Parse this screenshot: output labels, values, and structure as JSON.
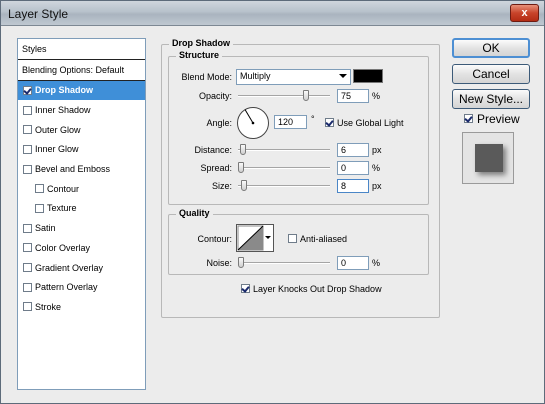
{
  "window": {
    "title": "Layer Style",
    "close_label": "x"
  },
  "styles_panel": {
    "header": "Styles",
    "blending_options": "Blending Options: Default",
    "items": [
      {
        "label": "Drop Shadow",
        "checked": true,
        "active": true,
        "sub": false
      },
      {
        "label": "Inner Shadow",
        "checked": false,
        "active": false,
        "sub": false
      },
      {
        "label": "Outer Glow",
        "checked": false,
        "active": false,
        "sub": false
      },
      {
        "label": "Inner Glow",
        "checked": false,
        "active": false,
        "sub": false
      },
      {
        "label": "Bevel and Emboss",
        "checked": false,
        "active": false,
        "sub": false
      },
      {
        "label": "Contour",
        "checked": false,
        "active": false,
        "sub": true
      },
      {
        "label": "Texture",
        "checked": false,
        "active": false,
        "sub": true
      },
      {
        "label": "Satin",
        "checked": false,
        "active": false,
        "sub": false
      },
      {
        "label": "Color Overlay",
        "checked": false,
        "active": false,
        "sub": false
      },
      {
        "label": "Gradient Overlay",
        "checked": false,
        "active": false,
        "sub": false
      },
      {
        "label": "Pattern Overlay",
        "checked": false,
        "active": false,
        "sub": false
      },
      {
        "label": "Stroke",
        "checked": false,
        "active": false,
        "sub": false
      }
    ]
  },
  "drop_shadow": {
    "title": "Drop Shadow",
    "structure": {
      "title": "Structure",
      "blend_mode_label": "Blend Mode:",
      "blend_mode_value": "Multiply",
      "shadow_color": "#000000",
      "opacity_label": "Opacity:",
      "opacity_value": "75",
      "opacity_unit": "%",
      "opacity_fraction": 0.75,
      "angle_label": "Angle:",
      "angle_value": "120",
      "angle_unit": "°",
      "use_global_light_label": "Use Global Light",
      "use_global_light_checked": true,
      "distance_label": "Distance:",
      "distance_value": "6",
      "distance_unit": "px",
      "distance_fraction": 0.02,
      "spread_label": "Spread:",
      "spread_value": "0",
      "spread_unit": "%",
      "spread_fraction": 0.0,
      "size_label": "Size:",
      "size_value": "8",
      "size_unit": "px",
      "size_fraction": 0.03
    },
    "quality": {
      "title": "Quality",
      "contour_label": "Contour:",
      "anti_aliased_label": "Anti-aliased",
      "anti_aliased_checked": false,
      "noise_label": "Noise:",
      "noise_value": "0",
      "noise_unit": "%",
      "noise_fraction": 0.0
    },
    "knocks_out_label": "Layer Knocks Out Drop Shadow",
    "knocks_out_checked": true
  },
  "actions": {
    "ok_label": "OK",
    "cancel_label": "Cancel",
    "new_style_label": "New Style...",
    "preview_label": "Preview",
    "preview_checked": true
  }
}
